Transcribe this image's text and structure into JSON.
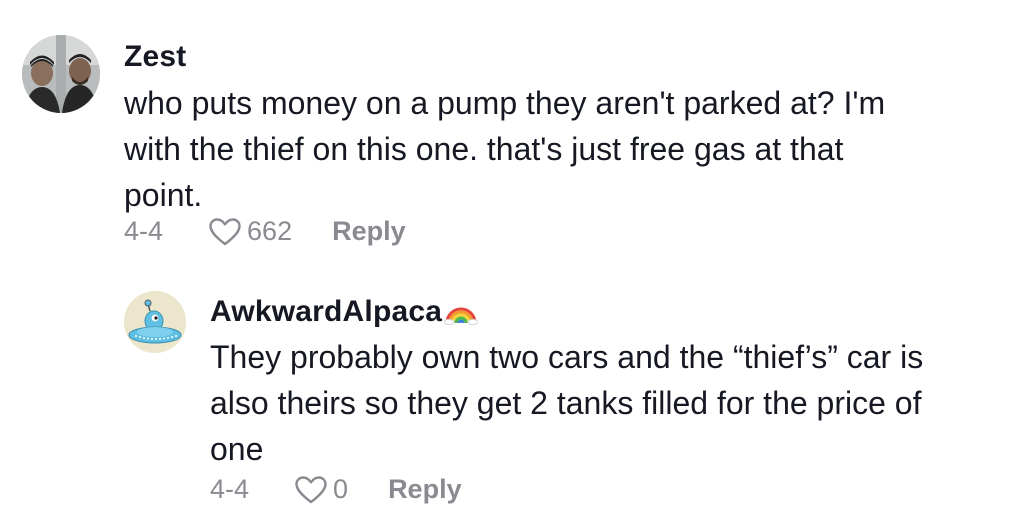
{
  "comments": [
    {
      "username": "Zest",
      "text": "who puts money on a pump they aren't parked at? I'm\nwith the thief on this one. that's just free gas at that\npoint.",
      "date": "4-4",
      "likes": "662",
      "reply_label": "Reply",
      "avatar_icon": "profile-photo-two-men"
    },
    {
      "username": "AwkwardAlpaca",
      "username_emoji": "rainbow-icon",
      "text": "They probably own two cars and the “thief’s” car is\nalso theirs so they get 2 tanks filled for the price of\none",
      "date": "4-4",
      "likes": "0",
      "reply_label": "Reply",
      "avatar_icon": "alien-ufo-avatar"
    }
  ],
  "colors": {
    "text": "#161823",
    "meta": "#8a8b91"
  }
}
